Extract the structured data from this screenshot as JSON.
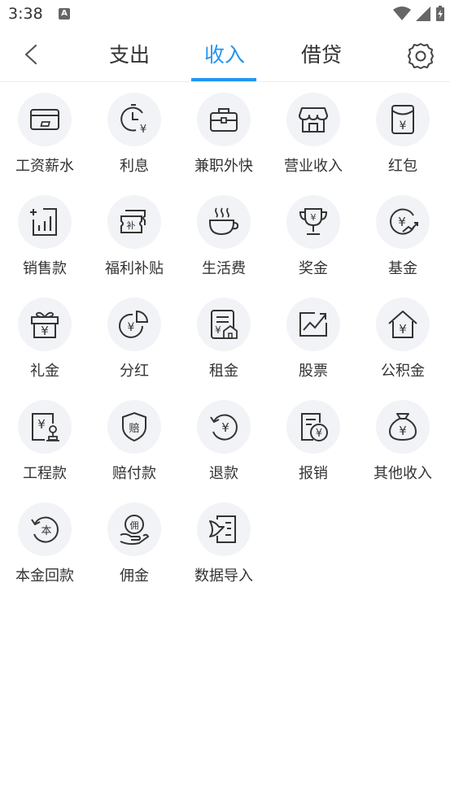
{
  "status": {
    "time": "3:38",
    "app_badge": "A"
  },
  "header": {
    "tabs": [
      {
        "label": "支出"
      },
      {
        "label": "收入"
      },
      {
        "label": "借贷"
      }
    ],
    "active_tab": "收入",
    "accent_color": "#2196f3"
  },
  "categories": [
    {
      "label": "工资薪水",
      "icon": "salary-card-icon"
    },
    {
      "label": "利息",
      "icon": "interest-clock-icon"
    },
    {
      "label": "兼职外快",
      "icon": "briefcase-icon"
    },
    {
      "label": "营业收入",
      "icon": "store-icon"
    },
    {
      "label": "红包",
      "icon": "red-envelope-icon"
    },
    {
      "label": "销售款",
      "icon": "sales-chart-icon"
    },
    {
      "label": "福利补贴",
      "icon": "subsidy-ticket-icon"
    },
    {
      "label": "生活费",
      "icon": "coffee-cup-icon"
    },
    {
      "label": "奖金",
      "icon": "trophy-icon"
    },
    {
      "label": "基金",
      "icon": "fund-growth-icon"
    },
    {
      "label": "礼金",
      "icon": "gift-box-icon"
    },
    {
      "label": "分红",
      "icon": "dividend-pie-icon"
    },
    {
      "label": "租金",
      "icon": "rent-document-icon"
    },
    {
      "label": "股票",
      "icon": "stock-chart-icon"
    },
    {
      "label": "公积金",
      "icon": "housing-fund-icon"
    },
    {
      "label": "工程款",
      "icon": "project-payment-icon"
    },
    {
      "label": "赔付款",
      "icon": "compensation-shield-icon"
    },
    {
      "label": "退款",
      "icon": "refund-arrow-icon"
    },
    {
      "label": "报销",
      "icon": "reimbursement-icon"
    },
    {
      "label": "其他收入",
      "icon": "money-bag-icon"
    },
    {
      "label": "本金回款",
      "icon": "principal-return-icon"
    },
    {
      "label": "佣金",
      "icon": "commission-hand-icon"
    },
    {
      "label": "数据导入",
      "icon": "data-import-icon"
    }
  ],
  "icon_glyphs": {
    "yen": "¥",
    "bu": "补",
    "pei": "赔",
    "ben": "本",
    "yong": "佣"
  }
}
